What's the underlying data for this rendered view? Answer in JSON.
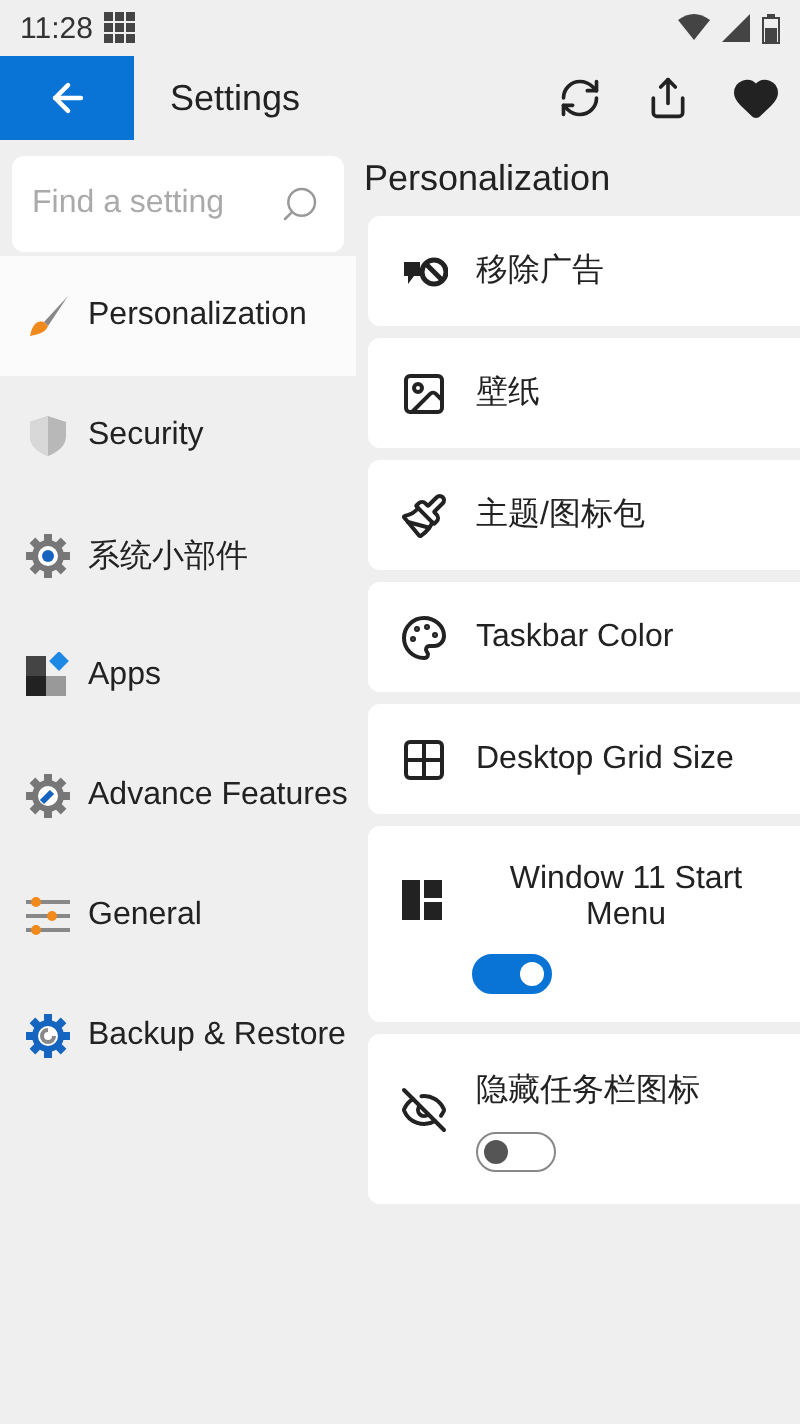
{
  "status_bar": {
    "time": "11:28"
  },
  "app_bar": {
    "title": "Settings"
  },
  "search": {
    "placeholder": "Find a setting"
  },
  "sidebar": {
    "items": [
      {
        "label": "Personalization",
        "selected": true
      },
      {
        "label": "Security",
        "selected": false
      },
      {
        "label": "系统小部件",
        "selected": false
      },
      {
        "label": "Apps",
        "selected": false
      },
      {
        "label": "Advance Features",
        "selected": false
      },
      {
        "label": "General",
        "selected": false
      },
      {
        "label": "Backup & Restore",
        "selected": false
      }
    ]
  },
  "section": {
    "title": "Personalization",
    "items": [
      {
        "kind": "link",
        "label": "移除广告"
      },
      {
        "kind": "link",
        "label": "壁纸"
      },
      {
        "kind": "link",
        "label": "主题/图标包"
      },
      {
        "kind": "link",
        "label": "Taskbar Color"
      },
      {
        "kind": "link",
        "label": "Desktop Grid Size"
      },
      {
        "kind": "toggle",
        "label": "Window 11 Start Menu",
        "on": true
      },
      {
        "kind": "toggle",
        "label": "隐藏任务栏图标",
        "on": false
      }
    ]
  }
}
